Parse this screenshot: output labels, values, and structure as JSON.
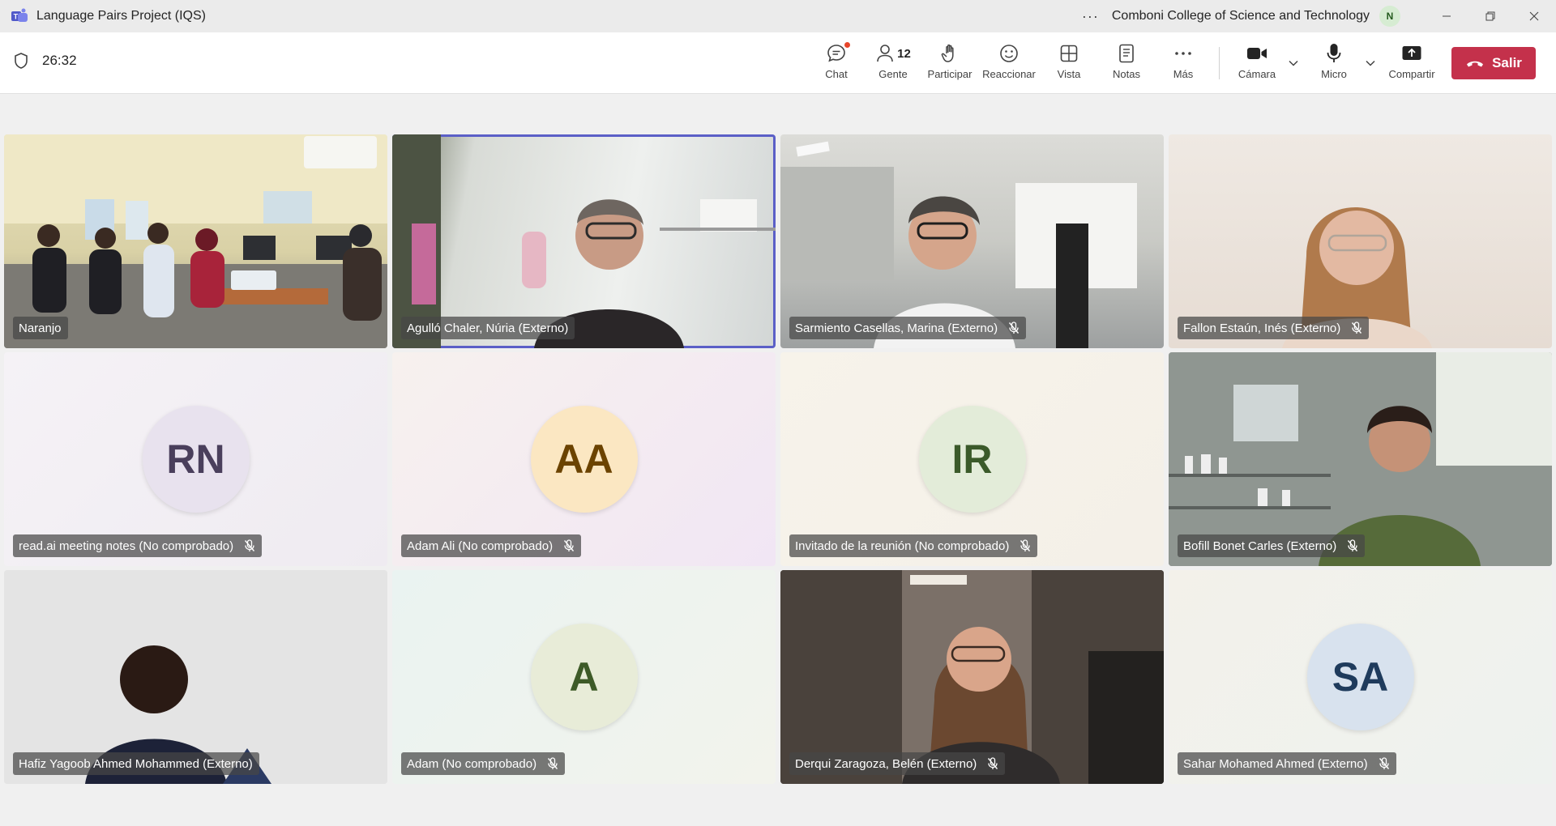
{
  "window": {
    "title": "Language Pairs Project (IQS)",
    "more_label": "···",
    "org": "Comboni College of Science and Technology",
    "org_avatar": "N"
  },
  "toolbar": {
    "timer": "26:32",
    "chat": "Chat",
    "people": "Gente",
    "people_count": "12",
    "raise": "Participar",
    "react": "Reaccionar",
    "view": "Vista",
    "notes": "Notas",
    "more": "Más",
    "camera": "Cámara",
    "mic": "Micro",
    "share": "Compartir",
    "leave": "Salir"
  },
  "participants": [
    {
      "name": "Naranjo",
      "muted": false,
      "video": true
    },
    {
      "name": "Agulló Chaler, Núria (Externo)",
      "muted": false,
      "video": true,
      "speaking": true
    },
    {
      "name": "Sarmiento Casellas, Marina (Externo)",
      "muted": true,
      "video": true
    },
    {
      "name": "Fallon Estaún, Inés (Externo)",
      "muted": true,
      "video": true
    },
    {
      "name": "read.ai meeting notes (No comprobado)",
      "muted": true,
      "initials": "RN",
      "avatar_bg": "#e8e2ee",
      "avatar_fg": "#4a3f5c"
    },
    {
      "name": "Adam Ali (No comprobado)",
      "muted": true,
      "initials": "AA",
      "avatar_bg": "#fbe7c2",
      "avatar_fg": "#6b4300"
    },
    {
      "name": "Invitado de la reunión (No comprobado)",
      "muted": true,
      "initials": "IR",
      "avatar_bg": "#e3ecd9",
      "avatar_fg": "#3b5a2a"
    },
    {
      "name": "Bofill Bonet Carles (Externo)",
      "muted": true,
      "video": true
    },
    {
      "name": "Hafiz Yagoob Ahmed Mohammed (Externo)",
      "muted": false,
      "video": true
    },
    {
      "name": "Adam (No comprobado)",
      "muted": true,
      "initials": "A",
      "avatar_bg": "#e8ecd8",
      "avatar_fg": "#3d5a27"
    },
    {
      "name": "Derqui Zaragoza, Belén (Externo)",
      "muted": true,
      "video": true
    },
    {
      "name": "Sahar Mohamed Ahmed (Externo)",
      "muted": true,
      "initials": "SA",
      "avatar_bg": "#d8e2ee",
      "avatar_fg": "#1f3b5c"
    }
  ],
  "colors": {
    "accent": "#5b5fc7",
    "leave": "#c4314b"
  }
}
